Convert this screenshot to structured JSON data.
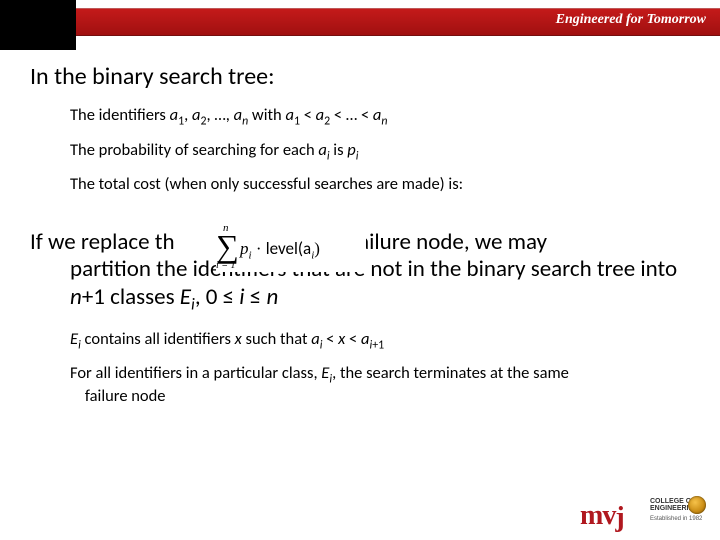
{
  "header": {
    "tagline": "Engineered for Tomorrow"
  },
  "slide": {
    "heading1": "In the binary search tree:",
    "bullets1": [
      "The identifiers a₁, a₂, …, aₙ with a₁ < a₂ < … < aₙ",
      "The probability of searching for each aᵢ is pᵢ",
      "The total cost (when only successful searches are made) is:"
    ],
    "heading2_line1": "If we replace the null subtree by a failure node, we may",
    "heading2_rest": "partition the identifiers that are not in the binary search tree into n+1 classes Eᵢ, 0 ≤ i ≤ n",
    "bullets2": [
      "Eᵢ contains all identifiers x such that aᵢ < x < aᵢ₊₁",
      "For all identifiers in a particular class, Eᵢ, the search terminates at the same failure node"
    ]
  },
  "formula": {
    "upper": "n",
    "lower": "i = 1",
    "pi": "p",
    "pi_sub": "i",
    "dot": " · ",
    "level": "level(a",
    "level_sub": "i",
    "close": ")"
  },
  "footer": {
    "brand": "mvj",
    "college_l1": "COLLEGE OF",
    "college_l2": "ENGINEERING",
    "est": "Established in 1982"
  }
}
